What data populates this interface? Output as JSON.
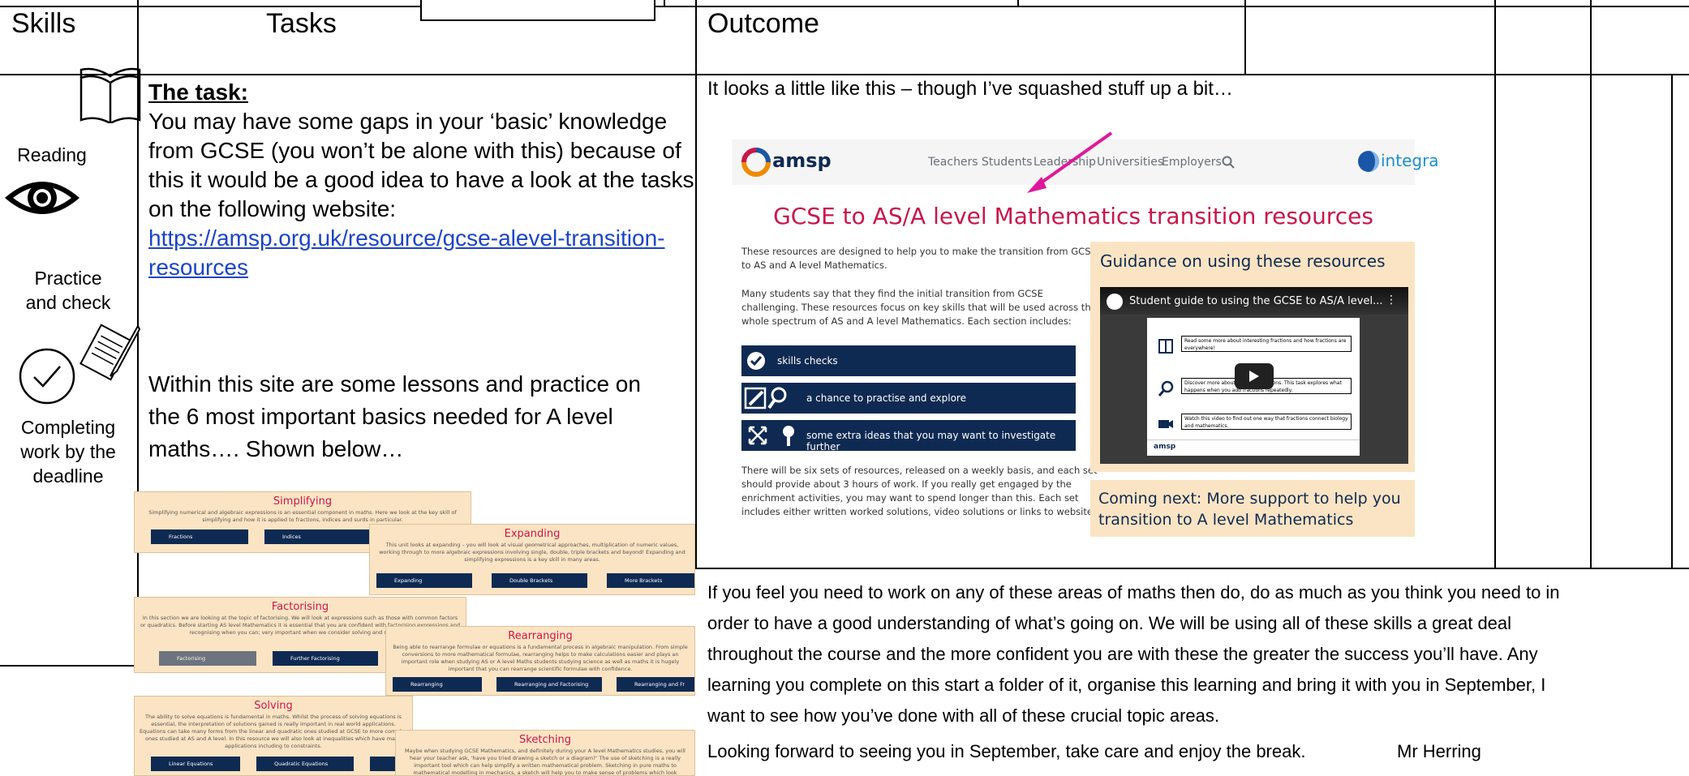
{
  "headers": {
    "skills": "Skills",
    "tasks": "Tasks",
    "outcome": "Outcome"
  },
  "skills": {
    "reading": "Reading",
    "practice_line1": "Practice",
    "practice_line2": "and check",
    "completing_line1": "Completing",
    "completing_line2": "work by the",
    "completing_line3": "deadline"
  },
  "task": {
    "heading": "The task:",
    "para1_lines": [
      "You may have some gaps in your ‘basic’ knowledge",
      "from GCSE (you won’t be alone with this) because of",
      "this it would be a good idea to have a look at the tasks",
      "on the following website:"
    ],
    "link_line1": "https://amsp.org.uk/resource/gcse-alevel-transition-",
    "link_line2": "resources",
    "para2_lines": [
      "Within this site are some lessons and practice on",
      "the 6 most important basics needed for A level",
      "maths…. Shown below…"
    ]
  },
  "outcome": {
    "intro": "It looks a little like this – though I’ve squashed stuff up a bit…"
  },
  "screenshot": {
    "logo_text": "amsp",
    "nav": [
      "Teachers",
      "Students",
      "Leadership",
      "Universities",
      "Employers"
    ],
    "partner_text": "integra",
    "title": "GCSE to AS/A level Mathematics transition resources",
    "intro1_lines": [
      "These resources are designed to help you to make the transition from GCSE",
      "to AS and A level Mathematics."
    ],
    "intro2_lines": [
      "Many students say that they find the initial transition from GCSE",
      "challenging. These resources focus on key skills that will be used across the",
      "whole spectrum of AS and A level Mathematics. Each section includes:"
    ],
    "bars": [
      "skills checks",
      "a chance to practise and explore",
      "some extra ideas that you may want to investigate further"
    ],
    "outro_lines": [
      "There will be six sets of resources, released on a weekly basis, and each set",
      "should provide about 3 hours of work. If you really get engaged by the",
      "enrichment activities, you may want to spend longer than this. Each set",
      "includes either written worked solutions, video solutions or links to websites."
    ],
    "guidance_title": "Guidance on using these resources",
    "video_title": "Student guide to using the GCSE to AS/A level...",
    "video_rows": [
      "Read some more about interesting fractions and how fractions are everywhere!",
      "Discover more about Egyptian fractions. This task explores what happens when you add fractions repeatedly.",
      "Watch this video to find out one way that fractions connect biology and mathematics."
    ],
    "video_logo": "amsp",
    "coming_next_line1": "Coming next: More support to help you",
    "coming_next_line2": "transition to A level Mathematics"
  },
  "thumbnails": [
    {
      "title": "Simplifying",
      "desc": "Simplifying numerical and algebraic expressions is an essential component in maths. Here we look at the key skill of simplifying and how it is applied to fractions, indices and surds in particular.",
      "buttons": [
        "Fractions",
        "Indices",
        ""
      ]
    },
    {
      "title": "Expanding",
      "desc": "This unit looks at expanding – you will look at visual geometrical approaches, multiplication of numeric values, working through to more algebraic expressions involving single, double, triple brackets and beyond! Expanding and simplifying expressions is a key skill in many areas.",
      "buttons": [
        "Expanding",
        "Double Brackets",
        "More Brackets"
      ]
    },
    {
      "title": "Factorising",
      "desc": "In this section we are looking at the topic of factorising. We will look at expressions such as those with common factors or quadratics. Before starting AS level Mathematics it is essential that you are confident with factorising expressions and recognising when you can; very important when we consider solving and sketching.",
      "buttons": [
        "Factorising",
        "Further Factorising",
        ""
      ]
    },
    {
      "title": "Rearranging",
      "desc": "Being able to rearrange formulae or equations is a fundamental process in algebraic manipulation. From simple conversions to more mathematical formulae, rearranging helps to make calculations easier and plays an important role when studying AS or A level Maths students studying science as well as maths it is hugely important that you can rearrange scientific formulae with confidence.",
      "buttons": [
        "Rearranging",
        "Rearranging and Factorising",
        "Rearranging and Fr"
      ]
    },
    {
      "title": "Solving",
      "desc": "The ability to solve equations is fundamental in maths. Whilst the process of solving equations is essential, the interpretation of solutions gained is really important in real world applications. Equations can take many forms from the linear and quadratic ones studied at GCSE to more complex ones studied at AS and A level. In this resource we will also look at inequalities which have many applications including to constraints.",
      "buttons": [
        "Linear Equations",
        "Quadratic Equations",
        ""
      ]
    },
    {
      "title": "Sketching",
      "desc": "Maybe when studying GCSE Mathematics, and definitely during your A level Mathematics studies, you will hear your teacher ask, 'have you tried drawing a sketch or a diagram?' The use of sketching is a really important tool which can help simplify a written mathematical problem. Sketching in pure maths to mathematical modelling in mechanics, a sketch will help you to make sense of problems which look extremely challenging.",
      "buttons": []
    }
  ],
  "closing": {
    "lines": [
      "If you feel you need to work on any of these areas of maths then do, do as much as you think you need to in",
      "order to have a good understanding of what’s going on. We will be using all of these skills a great deal",
      "throughout the course and the more confident you are with these the greater the success you’ll have. Any",
      "learning you complete on this start a folder of it, organise this learning and bring it with you in September, I",
      "want to see how you’ve done with all of these crucial topic areas."
    ],
    "signoff": "Looking forward to seeing you in September, take care and enjoy the break.",
    "signature": "Mr Herring"
  },
  "colors": {
    "accent": "#c8174b",
    "navy": "#0f2a52",
    "peach": "#fbe4c3",
    "link": "#1a44c8",
    "arrow": "#e0189a"
  }
}
